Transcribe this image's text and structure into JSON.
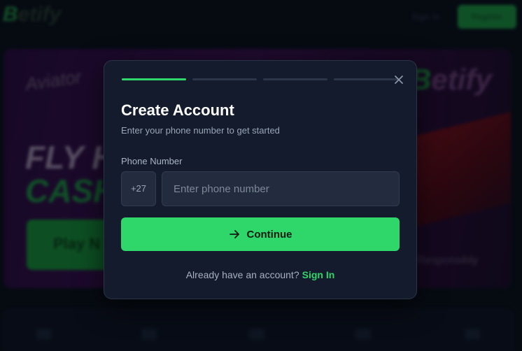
{
  "background": {
    "logo_letter": "B",
    "logo_rest": "etify",
    "sign_in_label": "Sign In",
    "register_label": "Register",
    "banner": {
      "game_logo": "Aviator",
      "headline_1": "FLY H",
      "headline_2": "CASH",
      "play_label": "Play N",
      "brand_letter": "B",
      "brand_rest": "etify",
      "responsible_text": "Responsibly"
    }
  },
  "modal": {
    "steps": [
      {
        "active": true
      },
      {
        "active": false
      },
      {
        "active": false
      },
      {
        "active": false
      }
    ],
    "close_icon": "close-icon",
    "title": "Create Account",
    "subtitle": "Enter your phone number to get started",
    "phone_label": "Phone Number",
    "country_code": "+27",
    "phone_placeholder": "Enter phone number",
    "phone_value": "",
    "continue_label": "Continue",
    "continue_icon": "arrow-right-icon",
    "footer_text": "Already have an account?",
    "footer_link": "Sign In"
  },
  "colors": {
    "accent": "#2fd66a",
    "modal_bg": "#131b2c",
    "input_bg": "#222c3e",
    "page_bg": "#0a0f19"
  }
}
